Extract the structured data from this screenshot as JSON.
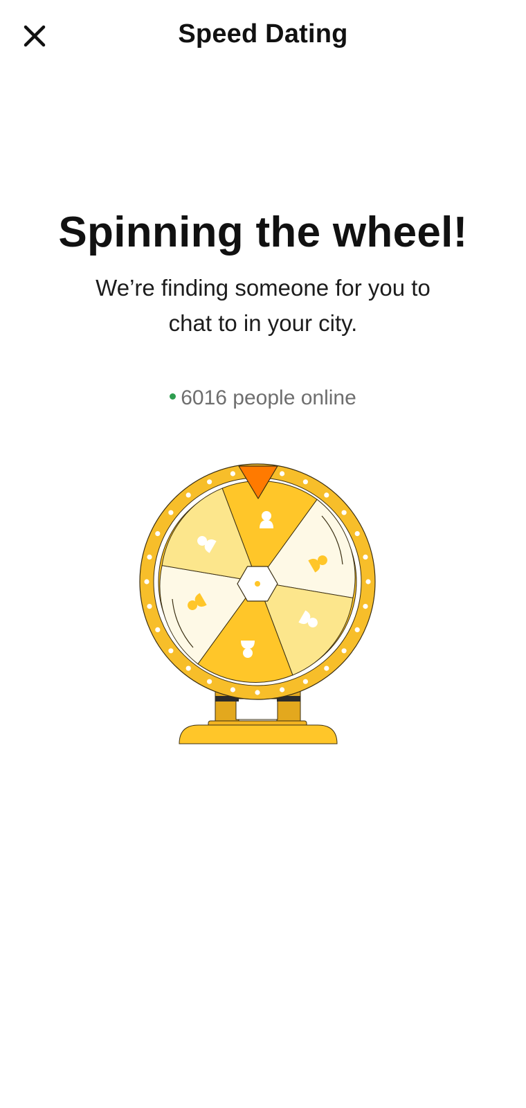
{
  "header": {
    "title": "Speed Dating",
    "close_icon": "close-icon"
  },
  "main": {
    "headline": "Spinning the wheel!",
    "subtitle": "We’re finding someone for you to chat to in your city.",
    "online_count": "6016",
    "online_suffix": "people online"
  },
  "illustration": {
    "name": "spinning-wheel",
    "colors": {
      "primary": "#FFC629",
      "rim": "#F7BE2A",
      "light": "#FCE68C",
      "cream": "#FEF9E6",
      "pointer": "#FF7A00",
      "stand": "#E3A81E",
      "outline": "#3A2E12"
    }
  },
  "colors": {
    "online_dot": "#2E9D4F",
    "muted_text": "#6E6E6E"
  }
}
